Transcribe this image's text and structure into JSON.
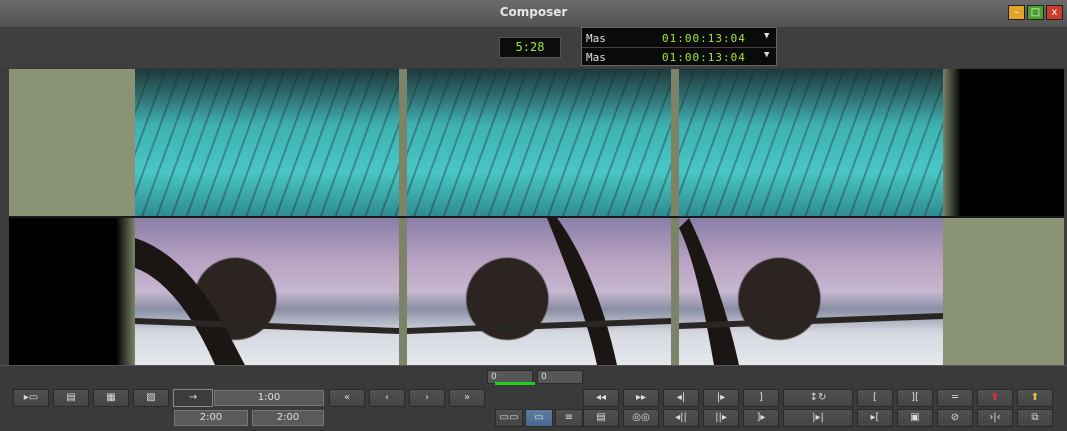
{
  "window": {
    "title": "Composer",
    "minimize": "–",
    "maximize": "□",
    "close": "x"
  },
  "header": {
    "timer": "5:28",
    "timecodes": [
      {
        "track": "Mas",
        "value": "01:00:13:04",
        "dropdown": "▼"
      },
      {
        "track": "Mas",
        "value": "01:00:13:04",
        "dropdown": "▼"
      }
    ]
  },
  "frames": {
    "top": [
      "olive",
      "water",
      "water",
      "water",
      "black"
    ],
    "bottom": [
      "black",
      "helicopter",
      "helicopter",
      "helicopter",
      "olive"
    ]
  },
  "scrub": {
    "left_value": "0",
    "right_value": "0"
  },
  "controls": {
    "row1": {
      "mode_icons": [
        "▸▭",
        "▤",
        "▦",
        "▨"
      ],
      "arrow": "→",
      "duration": "1:00",
      "nav": [
        "«",
        "‹",
        "›",
        "»"
      ],
      "transport": [
        "◂◂",
        "▸▸",
        "◂|",
        "|▸",
        "]",
        "↕↻",
        "[",
        "][",
        "═",
        "⬆",
        "⬆"
      ]
    },
    "row2": {
      "durations": [
        "2:00",
        "2:00"
      ],
      "tools": [
        "▭▭",
        "▭",
        "≡",
        "▤",
        "◎◎",
        "◂||",
        "||▸",
        "]▸",
        "|▸|",
        "▸[",
        "▣",
        "⊘",
        "›|‹",
        "⧉"
      ]
    }
  },
  "colors": {
    "timecode_green": "#9fe83a",
    "scrub_green": "#1fd11f",
    "selected_blue": "#48698f"
  }
}
